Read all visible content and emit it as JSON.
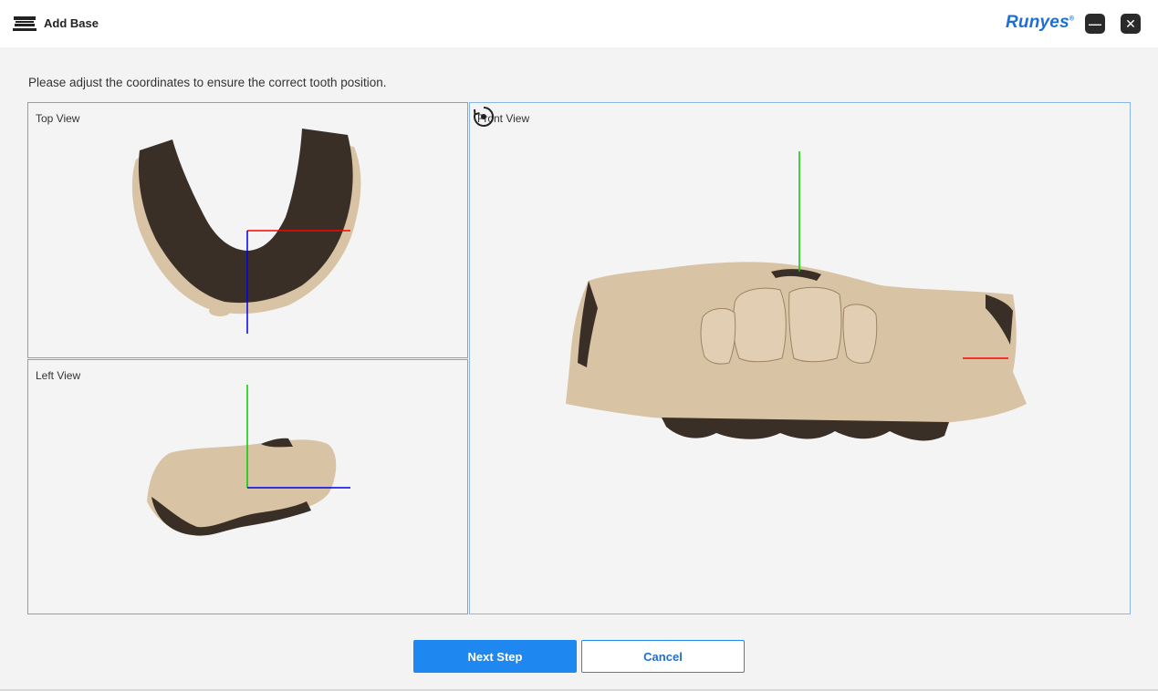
{
  "window": {
    "title": "Add Base",
    "brand": "Runyes",
    "brand_mark": "®",
    "app_icon": "dental-scanner-icon",
    "minimize_icon": "minimize-icon",
    "close_icon": "close-icon",
    "minimize_glyph": "—",
    "close_glyph": "✕"
  },
  "instruction": "Please adjust the coordinates to ensure the correct tooth position.",
  "views": {
    "top": {
      "label": "Top View"
    },
    "left": {
      "label": "Left View"
    },
    "front": {
      "label": "Front View",
      "reset_icon": "reset-view-icon"
    }
  },
  "axis_colors": {
    "x": "#ff0000",
    "y": "#00cc00",
    "z": "#0000ee"
  },
  "model_colors": {
    "tooth": "#d8c3a4",
    "dark": "#3a2f27"
  },
  "actions": {
    "next_label": "Next Step",
    "cancel_label": "Cancel"
  }
}
